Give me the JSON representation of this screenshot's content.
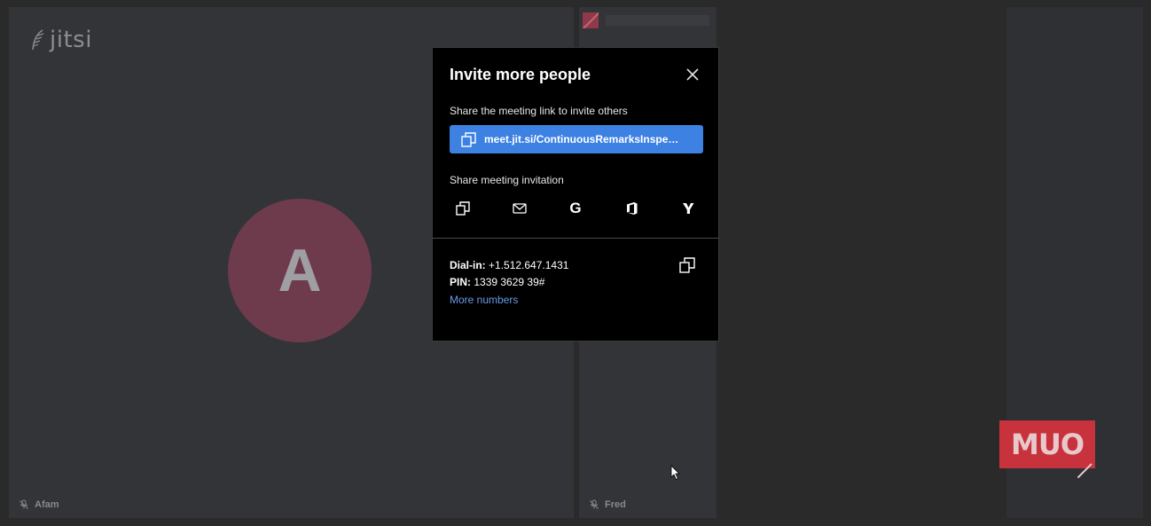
{
  "app": {
    "logo_text": "jitsi"
  },
  "main_tile": {
    "avatar_letter": "A",
    "participant_name": "Afam",
    "avatar_color": "#6e3b4c"
  },
  "side_tile": {
    "participant_name": "Fred"
  },
  "watermark": {
    "text": "MUO",
    "color": "#c8323c"
  },
  "dialog": {
    "title": "Invite more people",
    "share_link_label": "Share the meeting link to invite others",
    "meeting_link": "meet.jit.si/ContinuousRemarksInspect...",
    "share_invitation_label": "Share meeting invitation",
    "share_icons": [
      "copy-icon",
      "email-icon",
      "google-icon",
      "office-icon",
      "yahoo-icon"
    ],
    "dial_in_label": "Dial-in:",
    "dial_in_number": "+1.512.647.1431",
    "pin_label": "PIN:",
    "pin_value": "1339 3629 39#",
    "more_numbers": "More numbers",
    "link_button_color": "#3d81e3",
    "link_color": "#6a9ae8"
  }
}
